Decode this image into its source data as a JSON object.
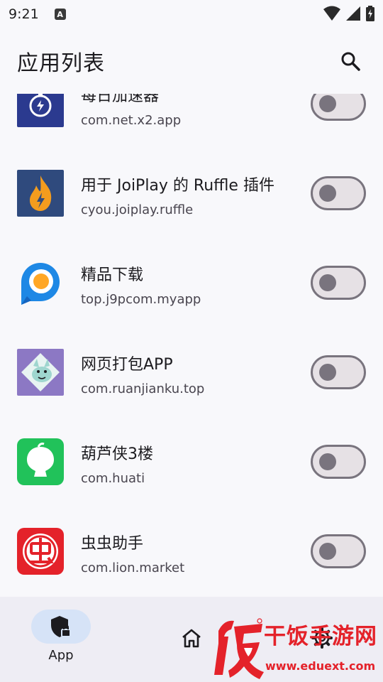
{
  "status_bar": {
    "time": "9:21",
    "app_icon_letter": "A"
  },
  "app_bar": {
    "title": "应用列表"
  },
  "apps": [
    {
      "name": "每日加速器",
      "package": "com.net.x2.app",
      "enabled": false,
      "icon": "stopwatch-icon",
      "icon_color": "#2b3a8f"
    },
    {
      "name": "用于 JoiPlay 的 Ruffle 插件",
      "package": "cyou.joiplay.ruffle",
      "enabled": false,
      "icon": "flame-icon",
      "icon_color": "#2f4a7d"
    },
    {
      "name": "精品下载",
      "package": "top.j9pcom.myapp",
      "enabled": false,
      "icon": "p-logo-icon",
      "icon_color": "#2196f3"
    },
    {
      "name": "网页打包APP",
      "package": "com.ruanjianku.top",
      "enabled": false,
      "icon": "dog-sticker-icon",
      "icon_color": "#8c78c4"
    },
    {
      "name": "葫芦侠3楼",
      "package": "com.huati",
      "enabled": false,
      "icon": "gourd-icon",
      "icon_color": "#21c25a"
    },
    {
      "name": "虫虫助手",
      "package": "com.lion.market",
      "enabled": false,
      "icon": "chong-icon",
      "icon_color": "#e4222a"
    }
  ],
  "bottom_nav": {
    "items": [
      {
        "label": "App",
        "icon": "shield-lock-icon",
        "selected": true
      },
      {
        "label": "",
        "icon": "home-icon",
        "selected": false
      },
      {
        "label": "",
        "icon": "gear-icon",
        "selected": false
      }
    ]
  },
  "watermark": {
    "title": "干饭手游网",
    "url": "www.eduext.com",
    "logo_char": "饭"
  },
  "colors": {
    "accent_pill": "#d6e3f7",
    "switch_off_track": "#e6e1e5",
    "switch_outline": "#79747e",
    "watermark_red": "#e4222a"
  }
}
